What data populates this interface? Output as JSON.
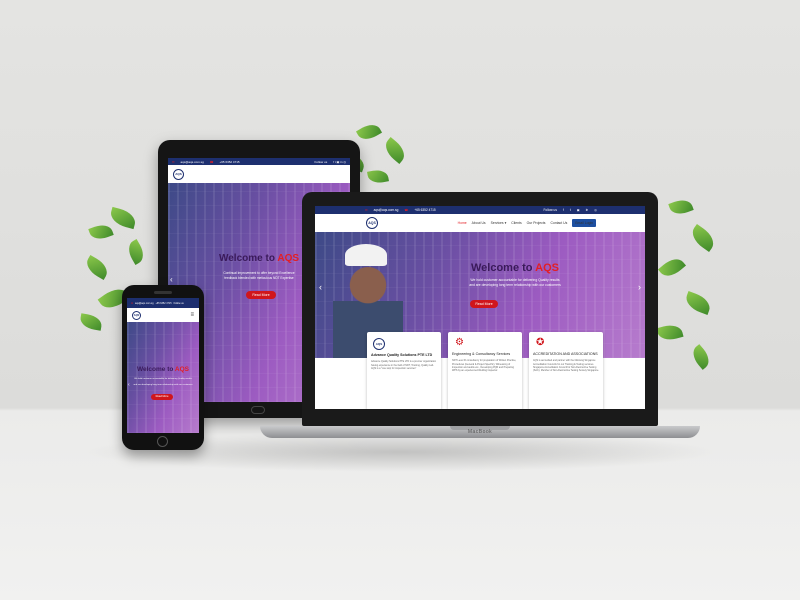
{
  "site": {
    "email": "aqs@aqs.com.sg",
    "phone": "+65 6352 4715",
    "follow_us": "Follow us",
    "logo_text": "AQS",
    "nav": [
      "Home",
      "About Us",
      "Services ▾",
      "Clients",
      "Our Projects",
      "Contact Us"
    ],
    "email_login": "Email Login",
    "hero_title_prefix": "Welcome to ",
    "hero_title_accent": "AQS",
    "hero_sub_line1": "We hold customer accountable for delivering Quality results",
    "hero_sub_line2": "and are developing long term relationship with our customers",
    "tablet_sub_line1": "Continual Improvement to offer beyond Excellence",
    "tablet_sub_line2": "feedback blended with meticulous NDT Expertise",
    "read_more": "Read More"
  },
  "cards": [
    {
      "title": "Advance Quality Solutions PTE LTD",
      "icon": "aqs-logo-icon",
      "desc": "Advance Quality Solutions PTE LTD is a premier organization having experience in the field of NDT, Training, Quality Lab. AQS is a \"one stop for inspection services\""
    },
    {
      "title": "Engineering & Consultancy Services",
      "icon": "hands-gear-icon",
      "desc": "NDT Level III consultancy for preparation of Written Practice, Procedures (General & Project Specific), Witnessing of Inspection and audits etc., Developing PQR and Preparing WPS by an experienced Welding Inspector."
    },
    {
      "title": "ACCREDITATION AND ASSOCIATIONS",
      "icon": "accreditation-icon",
      "desc": "AQS is accredited and partner with the following Singapore Accreditation Councils for our Training & Testing services. Singapore Accreditation Council for Non-Destructive Testing (SAC). Member of Non-Destructive Testing Society Singapore."
    }
  ],
  "laptop_brand": "MacBook",
  "colors": {
    "topbar": "#1d2f6f",
    "accent": "#e31e24",
    "cta": "#d0161c"
  }
}
